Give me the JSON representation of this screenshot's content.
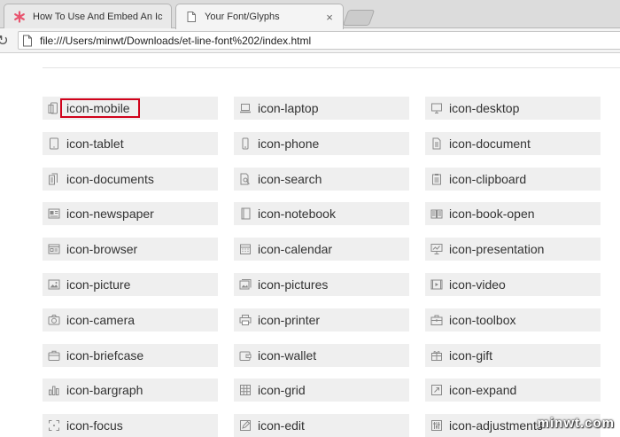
{
  "tabs": [
    {
      "title": "How To Use And Embed An Ic",
      "favicon": "asterisk-favicon-icon",
      "active": false
    },
    {
      "title": "Your Font/Glyphs",
      "favicon": "document-favicon-icon",
      "active": true
    }
  ],
  "tab_close_glyph": "×",
  "address": {
    "url": "file:///Users/minwt/Downloads/et-line-font%202/index.html"
  },
  "icons": [
    {
      "label": "icon-mobile",
      "icon": "mobile-icon"
    },
    {
      "label": "icon-laptop",
      "icon": "laptop-icon"
    },
    {
      "label": "icon-desktop",
      "icon": "desktop-icon"
    },
    {
      "label": "icon-tablet",
      "icon": "tablet-icon"
    },
    {
      "label": "icon-phone",
      "icon": "phone-icon"
    },
    {
      "label": "icon-document",
      "icon": "document-icon"
    },
    {
      "label": "icon-documents",
      "icon": "documents-icon"
    },
    {
      "label": "icon-search",
      "icon": "search-icon"
    },
    {
      "label": "icon-clipboard",
      "icon": "clipboard-icon"
    },
    {
      "label": "icon-newspaper",
      "icon": "newspaper-icon"
    },
    {
      "label": "icon-notebook",
      "icon": "notebook-icon"
    },
    {
      "label": "icon-book-open",
      "icon": "book-open-icon"
    },
    {
      "label": "icon-browser",
      "icon": "browser-icon"
    },
    {
      "label": "icon-calendar",
      "icon": "calendar-icon"
    },
    {
      "label": "icon-presentation",
      "icon": "presentation-icon"
    },
    {
      "label": "icon-picture",
      "icon": "picture-icon"
    },
    {
      "label": "icon-pictures",
      "icon": "pictures-icon"
    },
    {
      "label": "icon-video",
      "icon": "video-icon"
    },
    {
      "label": "icon-camera",
      "icon": "camera-icon"
    },
    {
      "label": "icon-printer",
      "icon": "printer-icon"
    },
    {
      "label": "icon-toolbox",
      "icon": "toolbox-icon"
    },
    {
      "label": "icon-briefcase",
      "icon": "briefcase-icon"
    },
    {
      "label": "icon-wallet",
      "icon": "wallet-icon"
    },
    {
      "label": "icon-gift",
      "icon": "gift-icon"
    },
    {
      "label": "icon-bargraph",
      "icon": "bargraph-icon"
    },
    {
      "label": "icon-grid",
      "icon": "grid-icon"
    },
    {
      "label": "icon-expand",
      "icon": "expand-icon"
    },
    {
      "label": "icon-focus",
      "icon": "focus-icon"
    },
    {
      "label": "icon-edit",
      "icon": "edit-icon"
    },
    {
      "label": "icon-adjustments",
      "icon": "adjustments-icon"
    }
  ],
  "highlighted": "icon-mobile",
  "watermark": "minwt.com",
  "colors": {
    "highlight": "#d0021b",
    "cell_bg": "#efefef",
    "icon": "#8a8a8a"
  }
}
